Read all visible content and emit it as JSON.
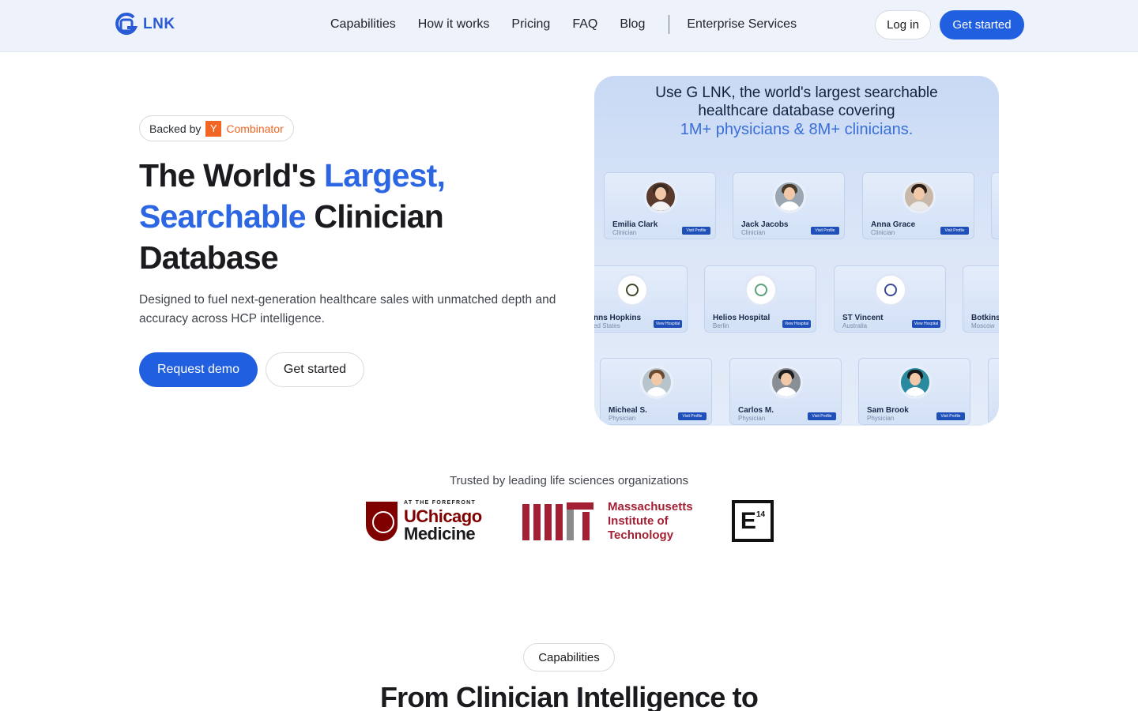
{
  "nav": {
    "logo_text": "LNK",
    "links": [
      "Capabilities",
      "How it works",
      "Pricing",
      "FAQ",
      "Blog"
    ],
    "enterprise": "Enterprise Services",
    "login": "Log in",
    "get_started": "Get started"
  },
  "hero": {
    "badge_prefix": "Backed by",
    "badge_y": "Y",
    "badge_combinator": "Combinator",
    "title_part1": "The World's ",
    "title_blue1": "Largest,",
    "title_blue2": "Searchable",
    "title_part2": " Clinician",
    "title_part3": "Database",
    "subtitle": "Designed to fuel next-generation healthcare sales with unmatched depth and accuracy across HCP intelligence.",
    "btn_demo": "Request demo",
    "btn_started": "Get started"
  },
  "panel": {
    "line1": "Use G LNK, the world's largest searchable",
    "line2": "healthcare database covering",
    "line3": "1M+ physicians & 8M+ clinicians.",
    "cards": [
      {
        "name": "Emilia Clark",
        "role": "Clinician",
        "btn": "Visit Profile"
      },
      {
        "name": "Jack Jacobs",
        "role": "Clinician",
        "btn": "Visit Profile"
      },
      {
        "name": "Anna Grace",
        "role": "Clinician",
        "btn": "Visit Profile"
      },
      {
        "name": "nns Hopkins",
        "role": "ed States",
        "btn": "View Hospital"
      },
      {
        "name": "Helios Hospital",
        "role": "Berlin",
        "btn": "View Hospital"
      },
      {
        "name": "ST Vincent",
        "role": "Australia",
        "btn": "View Hospital"
      },
      {
        "name": "Botkins",
        "role": "Moscow",
        "btn": ""
      },
      {
        "name": "Micheal S.",
        "role": "Physician",
        "btn": "Visit Profile"
      },
      {
        "name": "Carlos M.",
        "role": "Physician",
        "btn": "Visit Profile"
      },
      {
        "name": "Sam Brook",
        "role": "Physician",
        "btn": "Visit Profile"
      }
    ]
  },
  "trusted": {
    "label": "Trusted by leading life sciences organizations",
    "uchicago_small": "AT THE FOREFRONT",
    "uchicago_line1": "UChicago",
    "uchicago_line2": "Medicine",
    "mit_line1": "Massachusetts",
    "mit_line2": "Institute of",
    "mit_line3": "Technology",
    "e14_letter": "E",
    "e14_num": "14"
  },
  "capabilities": {
    "pill": "Capabilities",
    "title": "From Clinician Intelligence to"
  },
  "colors": {
    "primary": "#1f5fe0",
    "accent_blue": "#2d66e3",
    "yc_orange": "#f26625",
    "uchicago_maroon": "#800000",
    "mit_red": "#a31f34"
  }
}
